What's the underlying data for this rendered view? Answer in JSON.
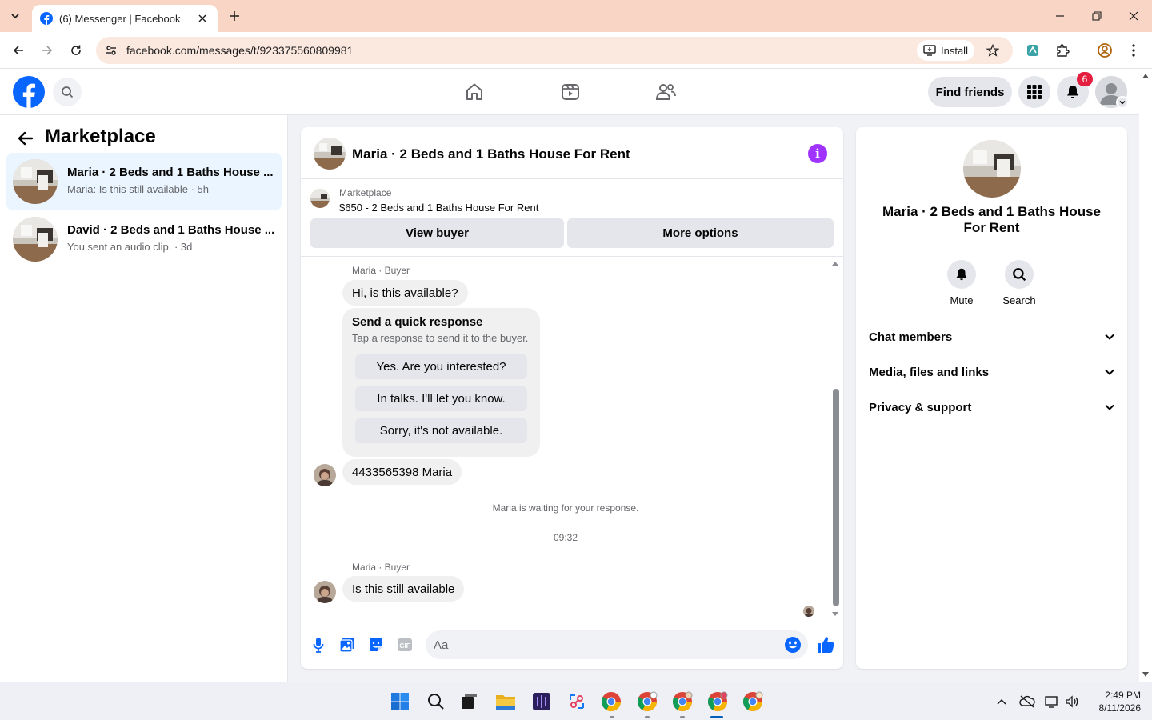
{
  "browser": {
    "tab_title": "(6) Messenger | Facebook",
    "url": "facebook.com/messages/t/923375560809981",
    "install_label": "Install"
  },
  "header": {
    "find_friends_label": "Find friends",
    "notification_count": "6"
  },
  "sidebar": {
    "title": "Marketplace",
    "conversations": [
      {
        "name": "Maria · 2 Beds and 1 Baths House ...",
        "subtitle": "Maria: Is this still available · 5h",
        "active": true
      },
      {
        "name": "David · 2 Beds and 1 Baths House ...",
        "subtitle": "You sent an audio clip. · 3d",
        "active": false
      }
    ]
  },
  "chat": {
    "title": "Maria · 2 Beds and 1 Baths House For Rent",
    "marketplace_label": "Marketplace",
    "listing": "$650 - 2 Beds and 1 Baths House For Rent",
    "view_buyer_label": "View buyer",
    "more_options_label": "More options",
    "sender_label_1": "Maria · Buyer",
    "message_1": "Hi, is this available?",
    "quick_title": "Send a quick response",
    "quick_subtitle": "Tap a response to send it to the buyer.",
    "quick_responses": [
      "Yes. Are you interested?",
      "In talks. I'll let you know.",
      "Sorry, it's not available."
    ],
    "message_2": "4433565398 Maria",
    "waiting_note": "Maria is waiting for your response.",
    "timestamp": "09:32",
    "sender_label_2": "Maria · Buyer",
    "message_3": "Is this still available",
    "composer_placeholder": "Aa"
  },
  "info_panel": {
    "name": "Maria · 2 Beds and 1 Baths House For Rent",
    "mute_label": "Mute",
    "search_label": "Search",
    "sections": [
      "Chat members",
      "Media, files and links",
      "Privacy & support"
    ]
  },
  "taskbar": {
    "time": "2:49 PM",
    "date": "8/11/2026"
  },
  "colors": {
    "facebook_blue": "#0866ff",
    "messenger_purple": "#a033ff",
    "active_conversation_bg": "#ebf5ff",
    "notification_red": "#e41e3f"
  }
}
